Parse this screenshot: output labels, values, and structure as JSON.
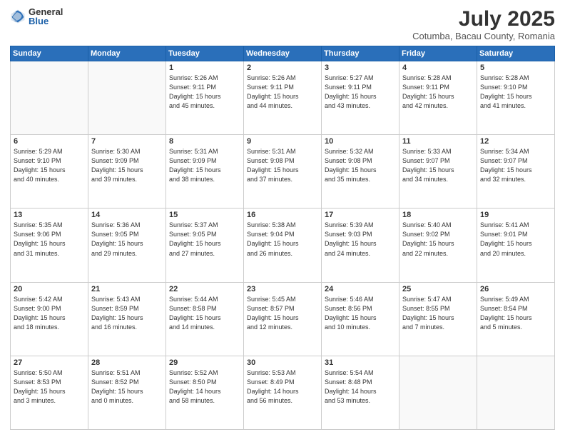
{
  "header": {
    "logo_general": "General",
    "logo_blue": "Blue",
    "month_year": "July 2025",
    "location": "Cotumba, Bacau County, Romania"
  },
  "weekdays": [
    "Sunday",
    "Monday",
    "Tuesday",
    "Wednesday",
    "Thursday",
    "Friday",
    "Saturday"
  ],
  "weeks": [
    [
      {
        "day": "",
        "info": ""
      },
      {
        "day": "",
        "info": ""
      },
      {
        "day": "1",
        "info": "Sunrise: 5:26 AM\nSunset: 9:11 PM\nDaylight: 15 hours\nand 45 minutes."
      },
      {
        "day": "2",
        "info": "Sunrise: 5:26 AM\nSunset: 9:11 PM\nDaylight: 15 hours\nand 44 minutes."
      },
      {
        "day": "3",
        "info": "Sunrise: 5:27 AM\nSunset: 9:11 PM\nDaylight: 15 hours\nand 43 minutes."
      },
      {
        "day": "4",
        "info": "Sunrise: 5:28 AM\nSunset: 9:11 PM\nDaylight: 15 hours\nand 42 minutes."
      },
      {
        "day": "5",
        "info": "Sunrise: 5:28 AM\nSunset: 9:10 PM\nDaylight: 15 hours\nand 41 minutes."
      }
    ],
    [
      {
        "day": "6",
        "info": "Sunrise: 5:29 AM\nSunset: 9:10 PM\nDaylight: 15 hours\nand 40 minutes."
      },
      {
        "day": "7",
        "info": "Sunrise: 5:30 AM\nSunset: 9:09 PM\nDaylight: 15 hours\nand 39 minutes."
      },
      {
        "day": "8",
        "info": "Sunrise: 5:31 AM\nSunset: 9:09 PM\nDaylight: 15 hours\nand 38 minutes."
      },
      {
        "day": "9",
        "info": "Sunrise: 5:31 AM\nSunset: 9:08 PM\nDaylight: 15 hours\nand 37 minutes."
      },
      {
        "day": "10",
        "info": "Sunrise: 5:32 AM\nSunset: 9:08 PM\nDaylight: 15 hours\nand 35 minutes."
      },
      {
        "day": "11",
        "info": "Sunrise: 5:33 AM\nSunset: 9:07 PM\nDaylight: 15 hours\nand 34 minutes."
      },
      {
        "day": "12",
        "info": "Sunrise: 5:34 AM\nSunset: 9:07 PM\nDaylight: 15 hours\nand 32 minutes."
      }
    ],
    [
      {
        "day": "13",
        "info": "Sunrise: 5:35 AM\nSunset: 9:06 PM\nDaylight: 15 hours\nand 31 minutes."
      },
      {
        "day": "14",
        "info": "Sunrise: 5:36 AM\nSunset: 9:05 PM\nDaylight: 15 hours\nand 29 minutes."
      },
      {
        "day": "15",
        "info": "Sunrise: 5:37 AM\nSunset: 9:05 PM\nDaylight: 15 hours\nand 27 minutes."
      },
      {
        "day": "16",
        "info": "Sunrise: 5:38 AM\nSunset: 9:04 PM\nDaylight: 15 hours\nand 26 minutes."
      },
      {
        "day": "17",
        "info": "Sunrise: 5:39 AM\nSunset: 9:03 PM\nDaylight: 15 hours\nand 24 minutes."
      },
      {
        "day": "18",
        "info": "Sunrise: 5:40 AM\nSunset: 9:02 PM\nDaylight: 15 hours\nand 22 minutes."
      },
      {
        "day": "19",
        "info": "Sunrise: 5:41 AM\nSunset: 9:01 PM\nDaylight: 15 hours\nand 20 minutes."
      }
    ],
    [
      {
        "day": "20",
        "info": "Sunrise: 5:42 AM\nSunset: 9:00 PM\nDaylight: 15 hours\nand 18 minutes."
      },
      {
        "day": "21",
        "info": "Sunrise: 5:43 AM\nSunset: 8:59 PM\nDaylight: 15 hours\nand 16 minutes."
      },
      {
        "day": "22",
        "info": "Sunrise: 5:44 AM\nSunset: 8:58 PM\nDaylight: 15 hours\nand 14 minutes."
      },
      {
        "day": "23",
        "info": "Sunrise: 5:45 AM\nSunset: 8:57 PM\nDaylight: 15 hours\nand 12 minutes."
      },
      {
        "day": "24",
        "info": "Sunrise: 5:46 AM\nSunset: 8:56 PM\nDaylight: 15 hours\nand 10 minutes."
      },
      {
        "day": "25",
        "info": "Sunrise: 5:47 AM\nSunset: 8:55 PM\nDaylight: 15 hours\nand 7 minutes."
      },
      {
        "day": "26",
        "info": "Sunrise: 5:49 AM\nSunset: 8:54 PM\nDaylight: 15 hours\nand 5 minutes."
      }
    ],
    [
      {
        "day": "27",
        "info": "Sunrise: 5:50 AM\nSunset: 8:53 PM\nDaylight: 15 hours\nand 3 minutes."
      },
      {
        "day": "28",
        "info": "Sunrise: 5:51 AM\nSunset: 8:52 PM\nDaylight: 15 hours\nand 0 minutes."
      },
      {
        "day": "29",
        "info": "Sunrise: 5:52 AM\nSunset: 8:50 PM\nDaylight: 14 hours\nand 58 minutes."
      },
      {
        "day": "30",
        "info": "Sunrise: 5:53 AM\nSunset: 8:49 PM\nDaylight: 14 hours\nand 56 minutes."
      },
      {
        "day": "31",
        "info": "Sunrise: 5:54 AM\nSunset: 8:48 PM\nDaylight: 14 hours\nand 53 minutes."
      },
      {
        "day": "",
        "info": ""
      },
      {
        "day": "",
        "info": ""
      }
    ]
  ]
}
